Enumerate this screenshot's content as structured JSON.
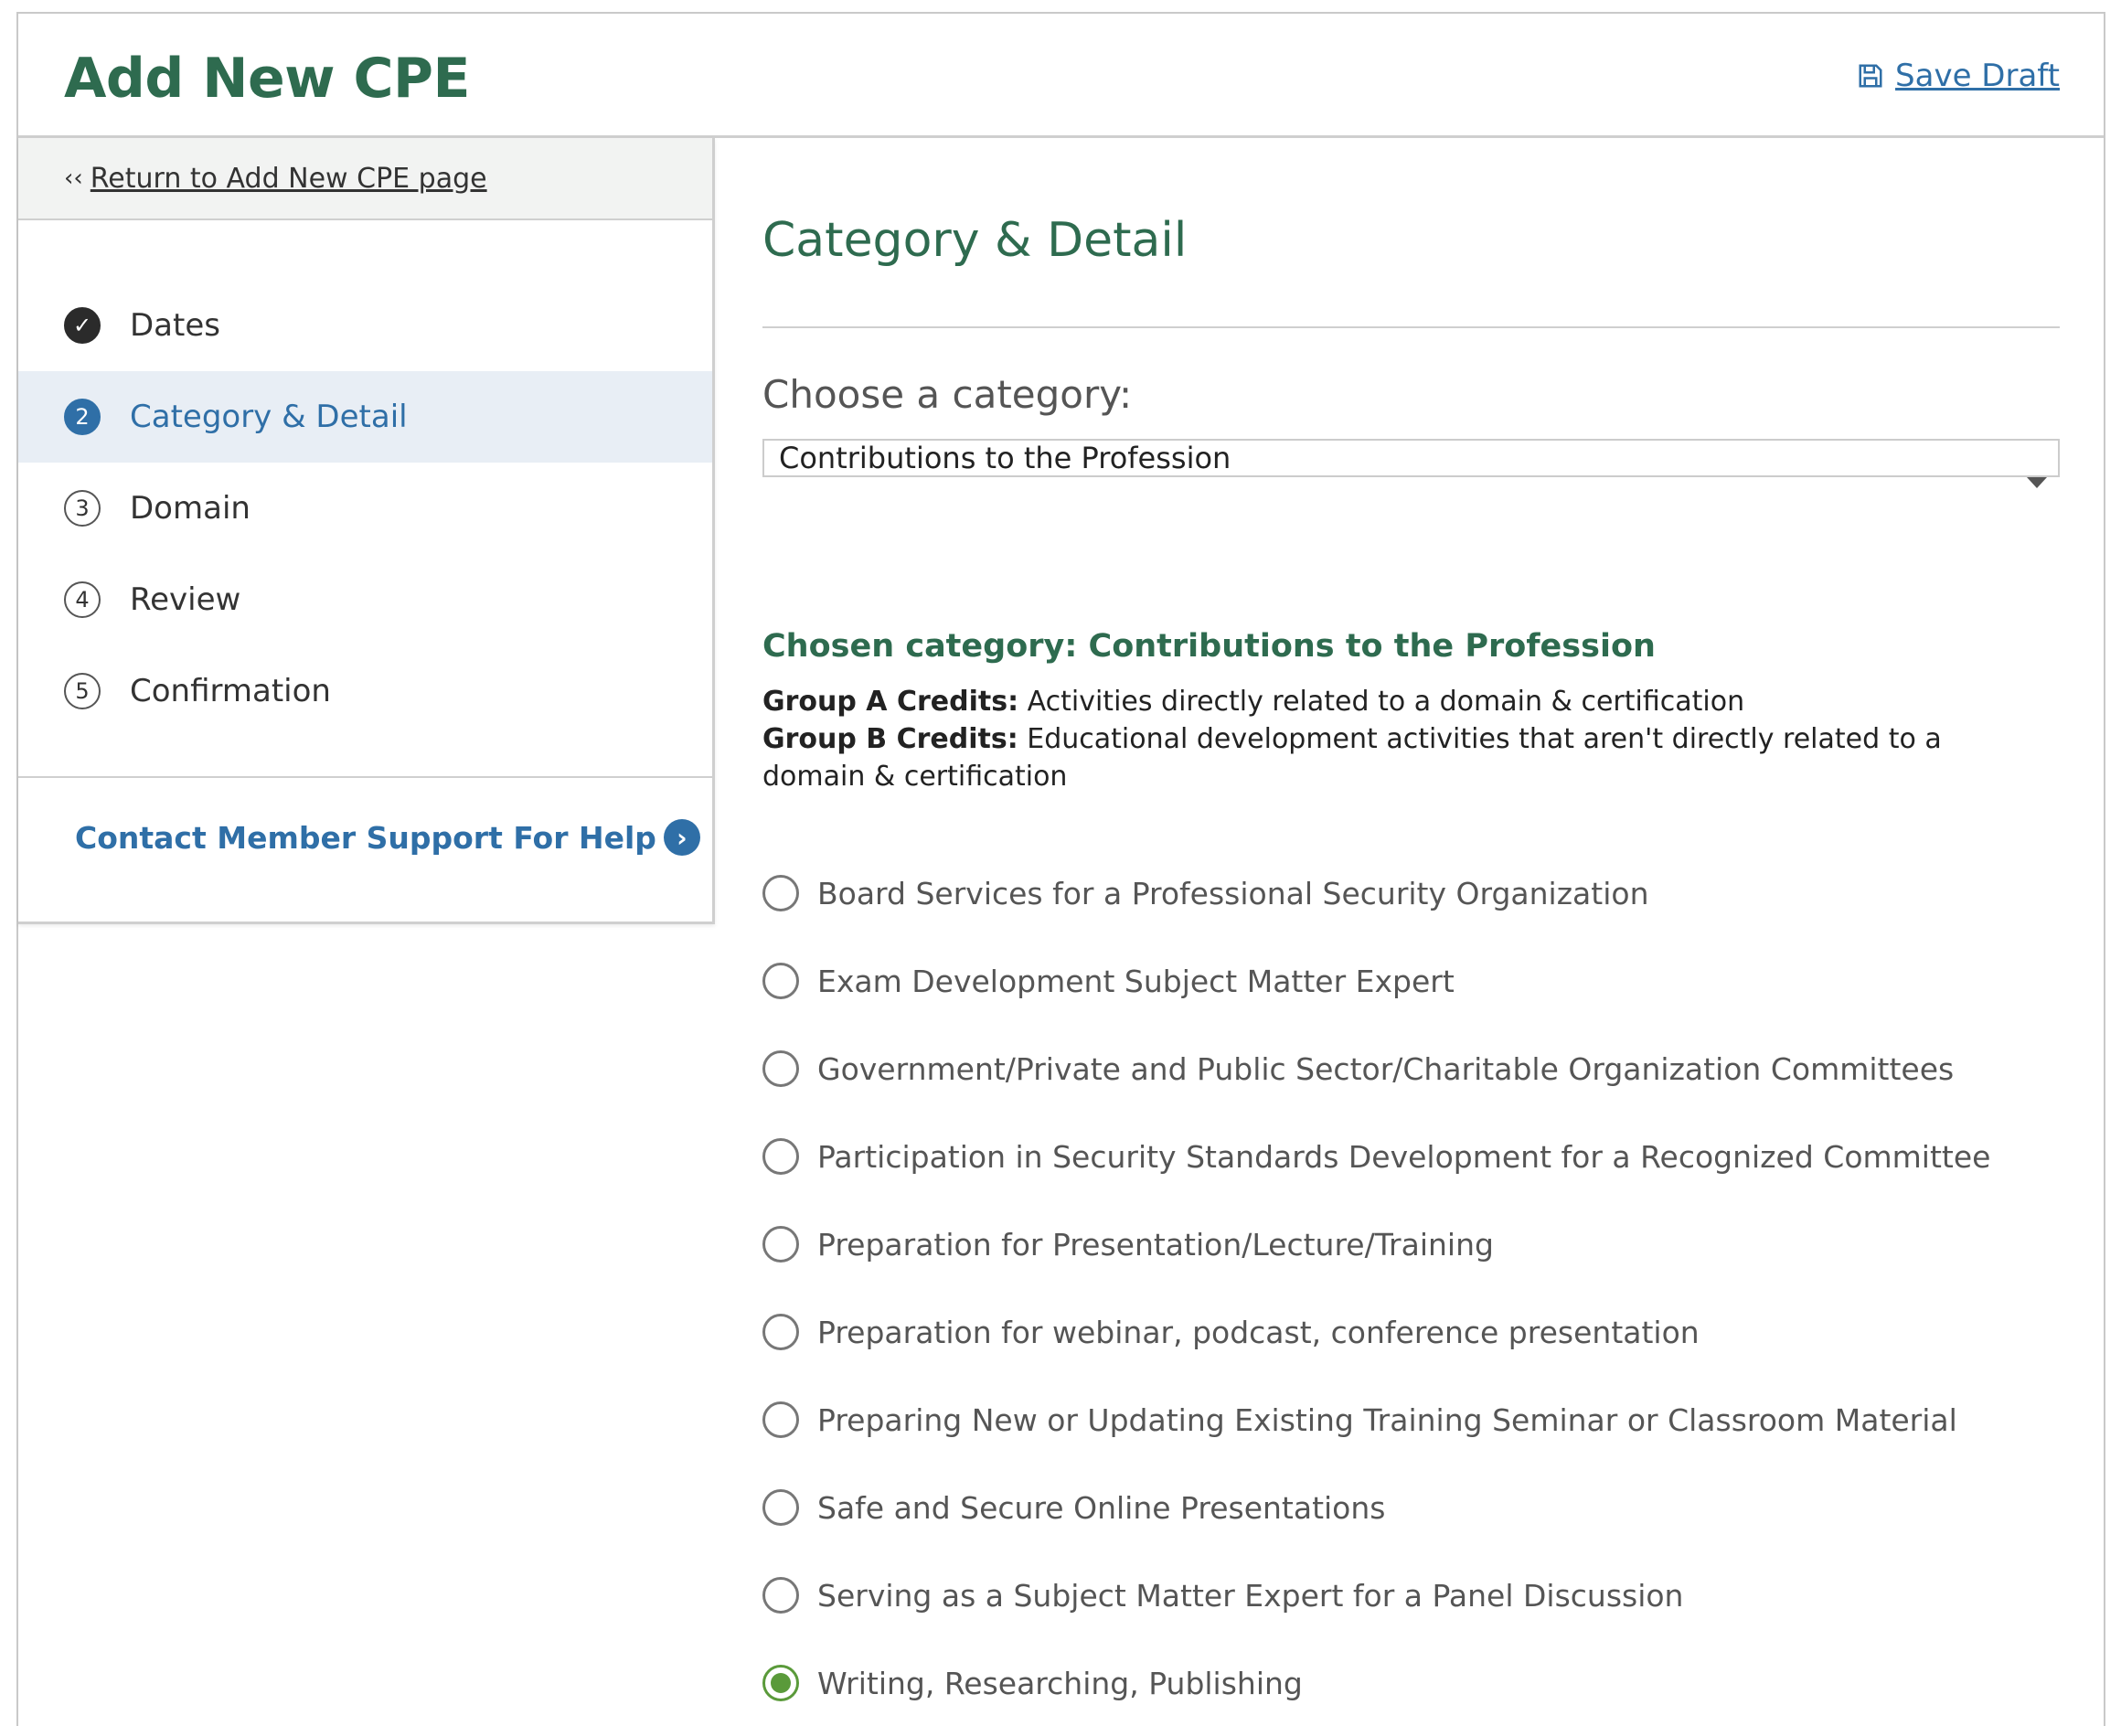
{
  "header": {
    "title": "Add New CPE",
    "save_draft": "Save Draft",
    "save_icon": "floppy-disk-icon"
  },
  "sidebar": {
    "return_chevron": "‹‹",
    "return_link": "Return to Add New CPE page",
    "steps": [
      {
        "badge": "✓",
        "label": "Dates",
        "state": "done"
      },
      {
        "badge": "2",
        "label": "Category & Detail",
        "state": "current"
      },
      {
        "badge": "3",
        "label": "Domain",
        "state": "pending"
      },
      {
        "badge": "4",
        "label": "Review",
        "state": "pending"
      },
      {
        "badge": "5",
        "label": "Confirmation",
        "state": "pending"
      }
    ],
    "support_link": "Contact Member Support For Help",
    "support_arrow": "›"
  },
  "main": {
    "section_title": "Category & Detail",
    "choose_label": "Choose a category:",
    "selected_category": "Contributions to the Profession",
    "chosen_title": "Chosen category: Contributions to the Profession",
    "group_a_label": "Group A Credits:",
    "group_a_text": "Activities directly related to a domain & certification",
    "group_b_label": "Group B Credits:",
    "group_b_text": "Educational development activities that aren't directly related to a domain & certification",
    "options": [
      {
        "label": "Board Services for a Professional Security Organization",
        "checked": false
      },
      {
        "label": "Exam Development Subject Matter Expert",
        "checked": false
      },
      {
        "label": "Government/Private and Public Sector/Charitable Organization Committees",
        "checked": false
      },
      {
        "label": "Participation in Security Standards Development for a Recognized Committee",
        "checked": false
      },
      {
        "label": "Preparation for Presentation/Lecture/Training",
        "checked": false
      },
      {
        "label": "Preparation for webinar, podcast, conference presentation",
        "checked": false
      },
      {
        "label": "Preparing New or Updating Existing Training Seminar or Classroom Material",
        "checked": false
      },
      {
        "label": "Safe and Secure Online Presentations",
        "checked": false
      },
      {
        "label": "Serving as a Subject Matter Expert for a Panel Discussion",
        "checked": false
      },
      {
        "label": "Writing, Researching, Publishing",
        "checked": true
      }
    ]
  },
  "colors": {
    "brand_green": "#2e6b4f",
    "link_blue": "#2f6fa7",
    "radio_checked": "#5a9a3a",
    "active_step_bg": "#e8eef5"
  }
}
